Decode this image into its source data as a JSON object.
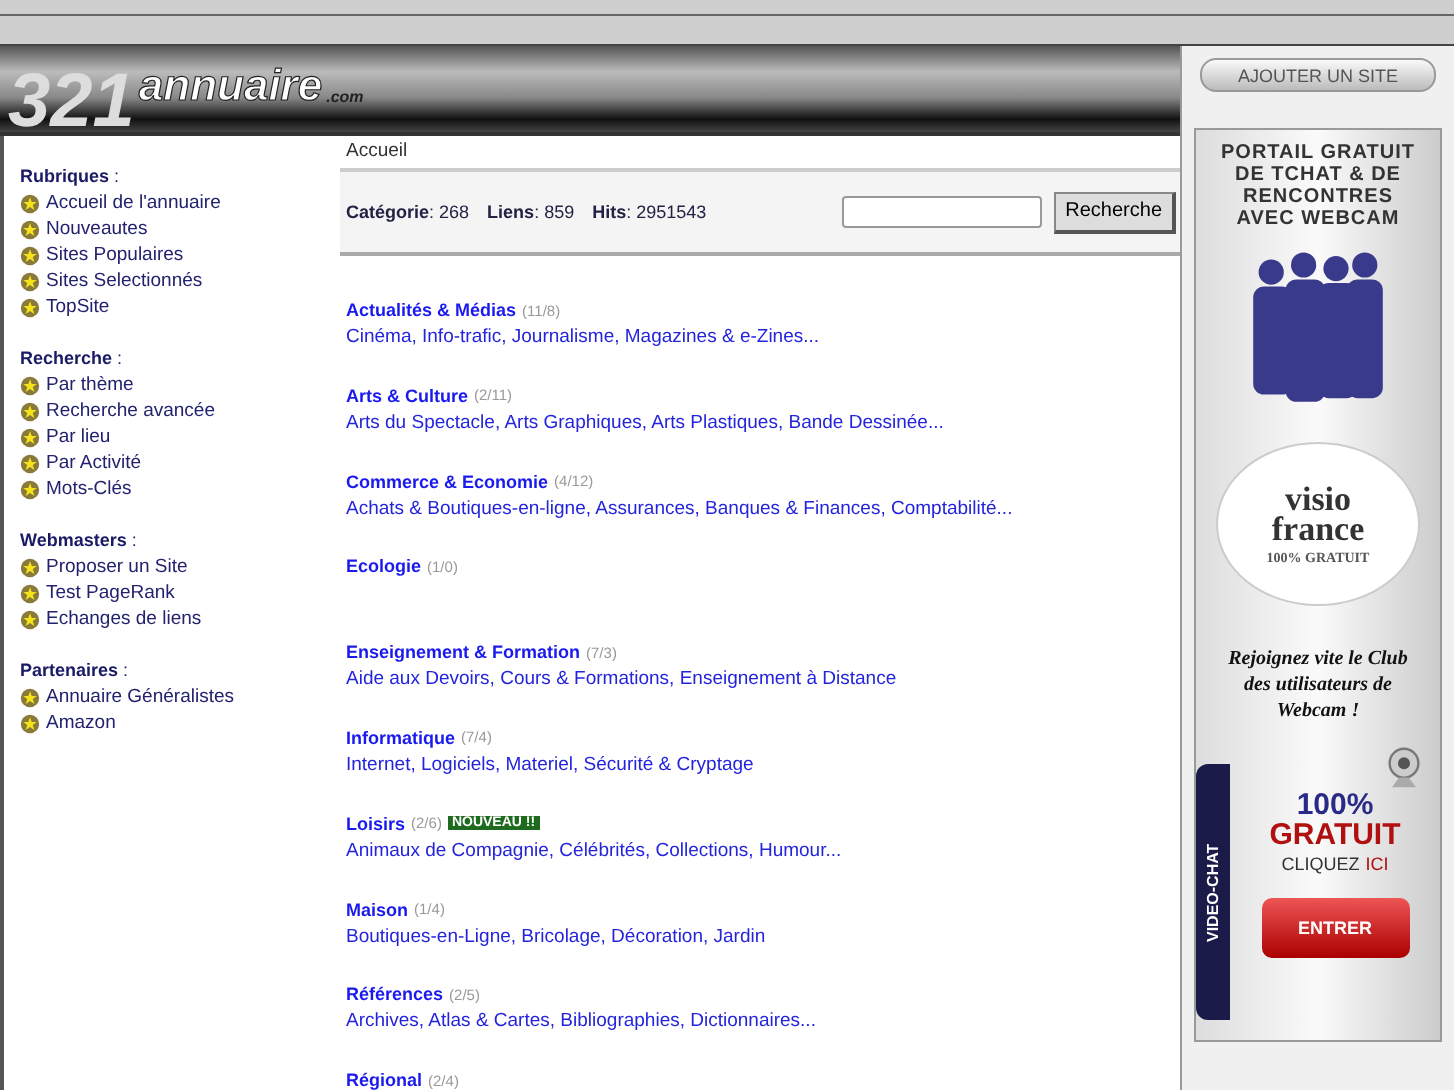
{
  "header": {
    "logo_number": "321",
    "logo_word": "annuaire",
    "logo_suffix": ".com",
    "add_site_button": "AJOUTER UN SITE"
  },
  "sidebar": {
    "sections": [
      {
        "title": "**Rubriques** :",
        "items": [
          "Accueil de l'annuaire",
          "Nouveautes",
          "Sites Populaires",
          "Sites Selectionnés",
          "TopSite"
        ]
      },
      {
        "title": "**Recherche** :",
        "items": [
          "Par thème",
          "Recherche avancée",
          "Par lieu",
          "Par Activité",
          "Mots-Clés"
        ]
      },
      {
        "title": "**Webmasters** :",
        "items": [
          "Proposer un Site",
          "Test PageRank",
          "Echanges de liens"
        ]
      },
      {
        "title": "**Partenaires** :",
        "items": [
          "Annuaire Généralistes",
          "Amazon"
        ]
      }
    ]
  },
  "breadcrumb": "Accueil",
  "stats": [
    "**Catégorie**: 268",
    "**Liens**: 859",
    "**Hits**: 2951543"
  ],
  "search": {
    "button": "Recherche"
  },
  "categories": [
    {
      "name": "Actualités & Médias",
      "count": "(11/8)",
      "subcategories": "Cinéma, Info-trafic, Journalisme, Magazines & e-Zines..."
    },
    {
      "name": "Arts & Culture",
      "count": "(2/11)",
      "subcategories": "Arts du Spectacle, Arts Graphiques, Arts Plastiques, Bande Dessinée..."
    },
    {
      "name": "Commerce & Economie",
      "count": "(4/12)",
      "subcategories": "Achats & Boutiques-en-ligne, Assurances, Banques & Finances, Comptabilité..."
    },
    {
      "name": "Ecologie",
      "count": "(1/0)"
    },
    {
      "name": "Enseignement & Formation",
      "count": "(7/3)",
      "subcategories": "Aide aux Devoirs, Cours & Formations, Enseignement à Distance"
    },
    {
      "name": "Informatique",
      "count": "(7/4)",
      "subcategories": "Internet, Logiciels, Materiel, Sécurité & Cryptage"
    },
    {
      "name": "Loisirs",
      "count": "(2/6)",
      "badge": "NOUVEAU !!",
      "subcategories": "Animaux de Compagnie, Célébrités, Collections, Humour..."
    },
    {
      "name": "Maison",
      "count": "(1/4)",
      "subcategories": "Boutiques-en-Ligne, Bricolage, Décoration, Jardin"
    },
    {
      "name": "Références",
      "count": "(2/5)",
      "subcategories": "Archives, Atlas & Cartes, Bibliographies, Dictionnaires..."
    },
    {
      "name": "Régional",
      "count": "(2/4)"
    }
  ],
  "ad": {
    "headline": [
      "PORTAIL GRATUIT",
      "DE TCHAT & DE",
      "RENCONTRES",
      "AVEC WEBCAM"
    ],
    "brand_top": "visio",
    "brand_bottom": "france",
    "brand_tagline": "100% GRATUIT",
    "slogan": "Rejoignez vite le Club des utilisateurs de Webcam !",
    "side_tab": "VIDEO-CHAT",
    "promo_percent": "100%",
    "promo_word": "GRATUIT",
    "click_text": "CLIQUEZ",
    "click_highlight": "ICI",
    "enter_button": "ENTRER"
  }
}
